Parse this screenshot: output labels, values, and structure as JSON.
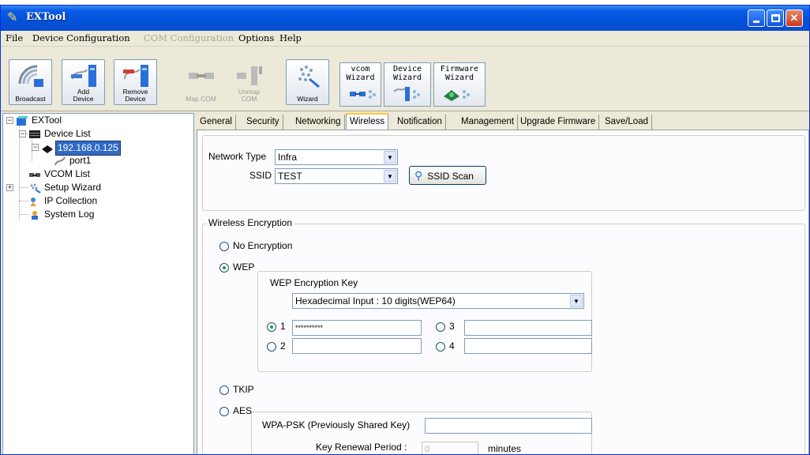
{
  "window": {
    "title": "EXTool"
  },
  "menu": {
    "items": [
      {
        "label": "File",
        "enabled": true
      },
      {
        "label": "Device Configuration",
        "enabled": true
      },
      {
        "label": "COM Configuration",
        "enabled": false
      },
      {
        "label": "Options",
        "enabled": true
      },
      {
        "label": "Help",
        "enabled": true
      }
    ]
  },
  "toolbar": {
    "broadcast": "Broadcast",
    "add_device": [
      "Add",
      "Device"
    ],
    "remove_device": [
      "Remove",
      "Device"
    ],
    "map_com": "Map COM",
    "unmap_com": [
      "Unmap",
      "COM"
    ],
    "wizard": "Wizard",
    "vcom_wizard": [
      "vcom",
      "Wizard"
    ],
    "device_wizard": [
      "Device",
      "Wizard"
    ],
    "firmware_wizard": [
      "Firmware",
      "Wizard"
    ]
  },
  "tree": {
    "root": "EXTool",
    "device_list": "Device List",
    "device_ip": "192.168.0.125",
    "port": "port1",
    "vcom_list": "VCOM List",
    "setup_wizard": "Setup Wizard",
    "ip_collection": "IP Collection",
    "system_log": "System Log"
  },
  "tabs": [
    "General",
    "Security",
    "Networking",
    "Wireless",
    "Notification",
    "Management",
    "Upgrade Firmware",
    "Save/Load"
  ],
  "active_tab": "Wireless",
  "wireless": {
    "network_type_label": "Network Type",
    "network_type_value": "Infra",
    "ssid_label": "SSID",
    "ssid_value": "TEST",
    "ssid_scan_button": "SSID Scan",
    "encryption_group": "Wireless Encryption",
    "enc_none": "No Encryption",
    "enc_wep": "WEP",
    "enc_tkip": "TKIP",
    "enc_aes": "AES",
    "selected_encryption": "WEP",
    "wep_key_group": "WEP Encryption Key",
    "wep_key_format": "Hexadecimal Input : 10 digits(WEP64)",
    "key1_label": "1",
    "key2_label": "2",
    "key3_label": "3",
    "key4_label": "4",
    "key1_value": "**********",
    "key2_value": "",
    "key3_value": "",
    "key4_value": "",
    "selected_key": "1",
    "wpa_psk_label": "WPA-PSK (Previously Shared Key)",
    "wpa_psk_value": "",
    "key_renewal_label": "Key Renewal Period :",
    "key_renewal_value": "0",
    "key_renewal_unit": "minutes"
  }
}
